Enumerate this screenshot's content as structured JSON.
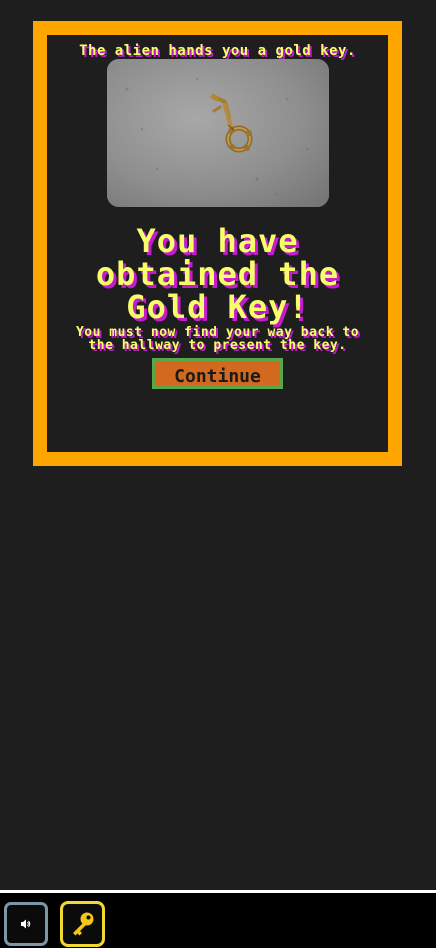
{
  "dialog": {
    "intro_text": "The alien hands you a gold key.",
    "image_icon": "gold-key-photo",
    "headline": "You have obtained the Gold Key!",
    "subtext": "You must now find your way back to the hallway to present the key.",
    "continue_label": "Continue"
  },
  "toolbar": {
    "sound_icon": "speaker-icon",
    "inventory_icon": "key-icon"
  },
  "colors": {
    "background": "#1e1e1e",
    "frame": "#ffa500",
    "text": "#f6ff6a",
    "text_shadow": "#c61ad0",
    "button_fill": "#d2691e",
    "button_border": "#5aa64a",
    "inventory_border": "#f0d830",
    "sound_border": "#7d97a8"
  }
}
